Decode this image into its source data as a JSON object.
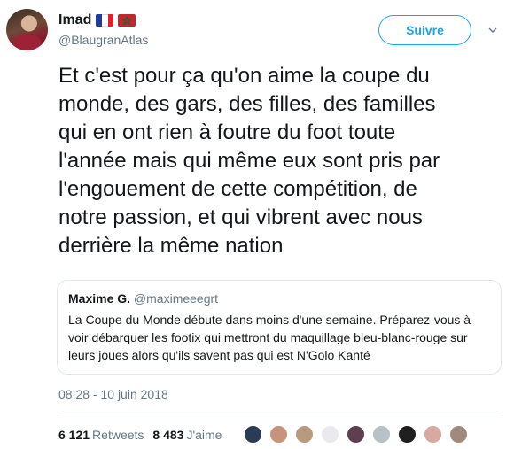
{
  "author": {
    "name": "Imad",
    "handle": "@BlaugranAtlas",
    "flags": [
      "france-flag",
      "morocco-flag"
    ]
  },
  "follow": {
    "label": "Suivre"
  },
  "tweet": {
    "lines": [
      "Et c'est pour ça qu'on aime la coupe du",
      "monde, des gars, des filles, des familles",
      "qui en ont rien à foutre du foot toute",
      "l'année mais qui même eux sont pris par",
      "l'engouement de cette compétition, de",
      "notre passion, et qui vibrent avec nous",
      "derrière la même nation"
    ]
  },
  "quoted": {
    "name": "Maxime G.",
    "handle": "@maximeeegrt",
    "lines": [
      "La Coupe du Monde débute dans moins d'une semaine. Préparez-vous à",
      "voir débarquer les footix qui mettront du maquillage bleu-blanc-rouge sur",
      "leurs joues alors qu'ils savent pas qui est N'Golo Kanté"
    ]
  },
  "timestamp": "08:28 - 10 juin 2018",
  "stats": {
    "retweets_count": "6 121",
    "retweets_label": "Retweets",
    "likes_count": "8 483",
    "likes_label": "J'aime"
  },
  "colors": {
    "accent": "#1da1f2",
    "muted": "#657786",
    "text": "#14171a",
    "border": "#e1e8ed"
  },
  "liker_avatars": [
    {
      "bg": "#2b3a55"
    },
    {
      "bg": "#c9927a"
    },
    {
      "bg": "#b89a7e"
    },
    {
      "bg": "#e9e9ee"
    },
    {
      "bg": "#5e3f4f"
    },
    {
      "bg": "#b8c0c8"
    },
    {
      "bg": "#1f1f1f"
    },
    {
      "bg": "#d8a9a0"
    },
    {
      "bg": "#9f8a7c"
    }
  ]
}
